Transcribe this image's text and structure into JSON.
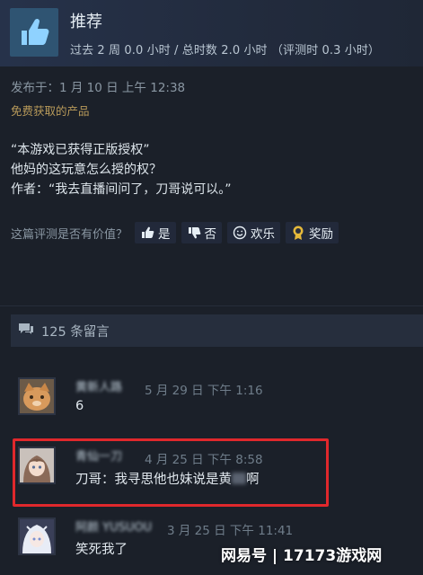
{
  "review": {
    "verdict": "推荐",
    "hours": "过去 2 周 0.0 小时 / 总时数 2.0 小时  （评测时 0.3 小时）",
    "posted": "发布于：1 月 10 日 上午 12:38",
    "free_product": "免费获取的产品",
    "body_lines": [
      "“本游戏已获得正版授权”",
      "他妈的这玩意怎么授的权？",
      "作者：“我去直播间问了，刀哥说可以。”"
    ],
    "thumb_icon": "thumbs-up-icon",
    "accent_color": "#2f5472"
  },
  "helpful": {
    "question": "这篇评测是否有价值？",
    "yes_label": "是",
    "no_label": "否",
    "funny_label": "欢乐",
    "award_label": "奖励"
  },
  "comments_header": {
    "label": "125 条留言"
  },
  "comments": [
    {
      "name": "黄新人路",
      "time": "5 月 29 日 下午 1:16",
      "text": "6",
      "avatar": "cat-avatar"
    },
    {
      "name": "青仙一刀",
      "time": "4 月 25 日 下午 8:58",
      "text": "刀哥：我寻思他也妹说是黄",
      "text_tail": "啊",
      "avatar": "anime-girl-avatar"
    },
    {
      "name": "阿颜 YUSUOU",
      "time": "3 月 25 日 下午 11:41",
      "text": "笑死我了",
      "avatar": "anime-white-hair-avatar"
    }
  ],
  "highlight_color": "#e0282c",
  "watermark": "网易号 | 17173游戏网"
}
